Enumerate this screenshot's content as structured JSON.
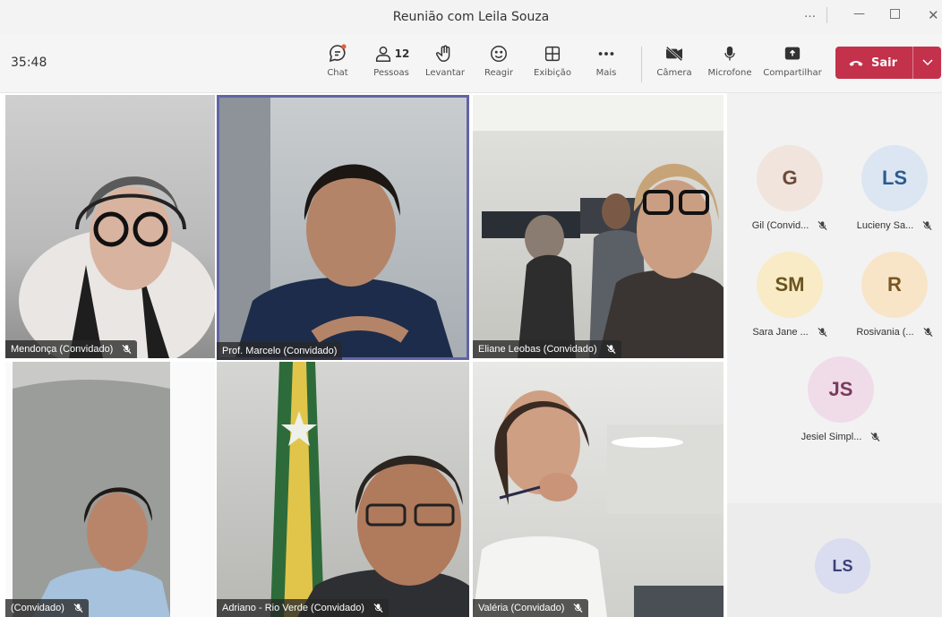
{
  "window": {
    "title": "Reunião com Leila Souza",
    "more": "…",
    "minimize": "—",
    "close": "✕"
  },
  "toolbar": {
    "timer": "35:48",
    "chat_label": "Chat",
    "people_label": "Pessoas",
    "people_count": "12",
    "raise_label": "Levantar",
    "react_label": "Reagir",
    "view_label": "Exibição",
    "more_label": "Mais",
    "camera_label": "Câmera",
    "mic_label": "Microfone",
    "share_label": "Compartilhar",
    "leave_label": "Sair",
    "leave_color": "#c4314b",
    "accent_color": "#6264a7"
  },
  "tiles": [
    {
      "name": "Mendonça (Convidado)"
    },
    {
      "name": "Prof. Marcelo (Convidado)"
    },
    {
      "name": "Eliane Leobas (Convidado)"
    },
    {
      "name": "(Convidado)"
    },
    {
      "name": "Adriano - Rio Verde (Convidado)"
    },
    {
      "name": "Valéria (Convidado)"
    }
  ],
  "roster": [
    {
      "initials": "G",
      "name": "Gil (Convid...",
      "bg": "#f1e4dc",
      "fg": "#6b4a3a"
    },
    {
      "initials": "LS",
      "name": "Lucieny Sa...",
      "bg": "#dce6f3",
      "fg": "#2c5b8f"
    },
    {
      "initials": "SM",
      "name": "Sara Jane ...",
      "bg": "#f8ebc6",
      "fg": "#6b5420"
    },
    {
      "initials": "R",
      "name": "Rosivania (...",
      "bg": "#f8e5c8",
      "fg": "#7a5520"
    },
    {
      "initials": "JS",
      "name": "Jesiel Simpl...",
      "bg": "#f0dce8",
      "fg": "#7a3a5e"
    }
  ],
  "self": {
    "initials": "LS"
  }
}
